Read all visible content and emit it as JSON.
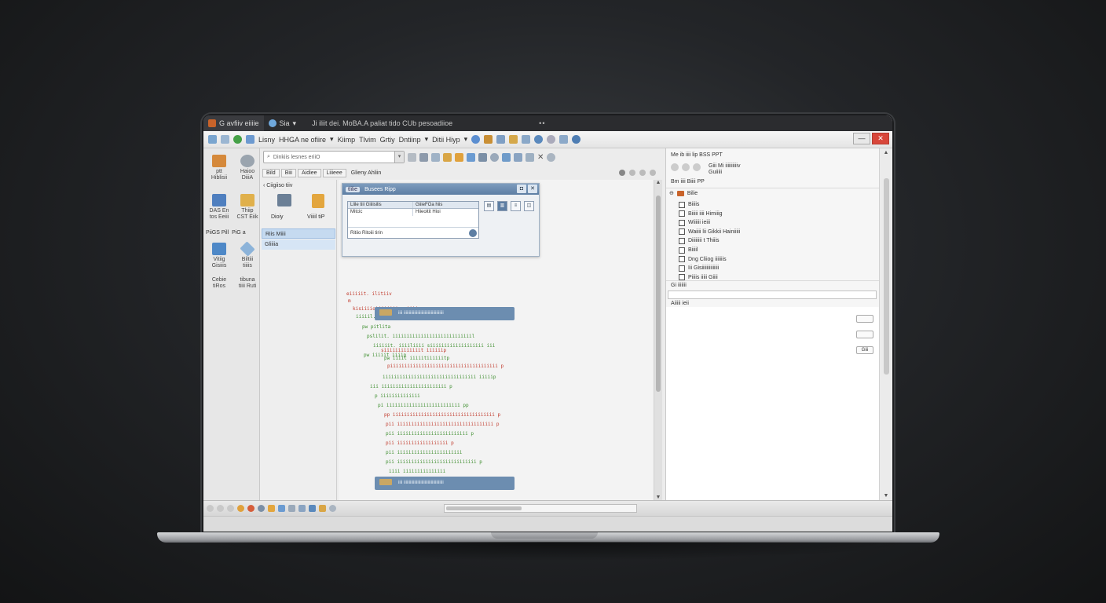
{
  "window": {
    "tab1": "G avfiiv eiiiie",
    "tab2": "Sia",
    "title": "Ji iliit dei. MoBA.A paliat tido CUb pesoadiioe",
    "title_dots": "••",
    "buttons": {
      "minimize": "—",
      "close": "✕"
    }
  },
  "menu": {
    "items": [
      "Lisny",
      "HHGA ne ofiire",
      "Kiimp",
      "Tlvim",
      "Grtiy",
      "Dntiinp",
      "Ditii Hiyp"
    ]
  },
  "toolbar": {
    "search_placeholder": "Dinkiis lesnes eriiO",
    "dropdown_glyph": "▾"
  },
  "left_strip": {
    "items": [
      {
        "label": "Hiblisii",
        "label2": "ptt"
      },
      {
        "label": "Haioo",
        "label2": "DiiiA"
      },
      {
        "label": "DAS En",
        "label2": "tos Eeiii"
      },
      {
        "label": "Thiip",
        "label2": "CST Eiik"
      }
    ],
    "header": "PiiGS Pill",
    "header2": "PiG a",
    "items2": [
      {
        "label": "Vitiig",
        "label2": "Gisiiis"
      },
      {
        "label": "Biltiii",
        "label2": "tiiiis"
      },
      {
        "label": "Cebie",
        "label2": "tiRos"
      },
      {
        "label": "tibuna",
        "label2": "tiiii Ruti"
      }
    ]
  },
  "tabs": [
    "Bild",
    "Biii",
    "Aidiee",
    "Liiieee",
    "Glieny Ahliin"
  ],
  "side_panel": {
    "path": "Ciigiiso tiiv",
    "icons": [
      {
        "label": "Dioiy"
      },
      {
        "label": "Viiiil tiP"
      }
    ],
    "selected_1": "Riis Miiii",
    "selected_2": "Gliiiia"
  },
  "dialog": {
    "title_pill": "tlilie",
    "title": "Busees Ripp",
    "close": "✕",
    "pin": "◘",
    "table": {
      "headers": [
        "Llile tiii Giiiisilis",
        "GiiieFOa hiis"
      ],
      "rows": [
        [
          "Mitcic",
          "Hiieoitit Hioi"
        ]
      ],
      "footer": "Ritiio Ritoiii tirin"
    },
    "buttons": [
      "▤",
      "▥",
      "≡",
      "◫"
    ]
  },
  "code": [
    {
      "t": "eiiiiit. ilitiiv",
      "c": "red"
    },
    {
      "t": "m",
      "c": "red"
    },
    {
      "t": "kisiiiioiiiiiiiioa iiiimp",
      "c": "red"
    },
    {
      "t": "iiiiil. eiliiini sisiiiisiaioiiiiioiinl",
      "c": "green"
    },
    {
      "t": "pw pitlita",
      "c": "green"
    },
    {
      "t": "pslilit. iiiiiiiiiiiiiiiiiiiiiiiiiiiil",
      "c": "green"
    },
    {
      "t": "iiiiiit. iiiiliiii siiiiiiiiiiiiiiiiiii iii",
      "c": "green"
    },
    {
      "t": "pw iiiiit iiiip",
      "c": "green"
    },
    {
      "t": "siiiiiiiiiiiiit iiiiiip",
      "c": "red"
    },
    {
      "t": "pw iiiit iiiiitiiiiiitp",
      "c": "green"
    },
    {
      "t": "piiiiiiiiiiiiiiiiiiiiiiiiiiiiiiiiiiiiii p",
      "c": "red"
    },
    {
      "t": "iiiiiiiiiiiiiiiiiiiiiiiiiiiiiiiii iiiiip",
      "c": "green"
    },
    {
      "t": "iii iiiiiiiiiiiiiiiiiiiiiii p",
      "c": "green"
    },
    {
      "t": "p iiiiiiiiiiiiii",
      "c": "green"
    },
    {
      "t": "pi iiiiiiiiiiiiiiiiiiiiiiiiii pp",
      "c": "green"
    },
    {
      "t": "pp iiiiiiiiiiiiiiiiiiiiiiiiiiiiiiiiiiii p",
      "c": "red"
    },
    {
      "t": "pii iiiiiiiiiiiiiiiiiiiiiiiiiiiiiiiiii p",
      "c": "red"
    },
    {
      "t": "pii iiiiiiiiiiiiiiiiiiiiiiiii p",
      "c": "green"
    },
    {
      "t": "pii iiiiiiiiiiiiiiiiii p",
      "c": "red"
    },
    {
      "t": "pii iiiiiiiiiiiiiiiiiiiiiii",
      "c": "green"
    },
    {
      "t": "pii iiiiiiiiiiiiiiiiiiiiiiiiiiii p",
      "c": "green"
    },
    {
      "t": "iiii iiiiiiiiiiiiiii",
      "c": "green"
    },
    {
      "t": "iiiiiiiiiiiiiiiiiiiiiiiiiiiiiiiiiii",
      "c": "green"
    }
  ],
  "code_block_bar": {
    "text": "iiii iiiiiiiiiiiiiiiiiiiiiiiiiiiiiiiiiiiiii"
  },
  "right_panel": {
    "header": "Me ib iiii lip BSS PPT",
    "subheader": "Giii Mi iiiiiiiiiiv",
    "subheader2": "Guiiiii",
    "breadcrumb": "Bm iiii Biiii PP",
    "tree_root": "Bilie",
    "tree": [
      "Biiiis",
      "Biiiii iiii Himiiig",
      "Wiiiiii ieiii",
      "Waiiii lii Gikkii Hainiiiii",
      "Diiiiiiii t Thiiis",
      "Biiiil",
      "Dng Cliiog iiiiiiis",
      "Iii Gisiiiiiiiiiiiiii",
      "Piiiis iiiii Giiii"
    ],
    "filter_label": "Gi iiiiiii",
    "filter_label2": "Aiiiii ieii",
    "buttons": [
      "",
      "",
      "Giii"
    ]
  },
  "colors": {
    "accent": "#6c8db0",
    "close": "#d8463a",
    "code_red": "#c0392b",
    "code_green": "#3e8e2f"
  }
}
